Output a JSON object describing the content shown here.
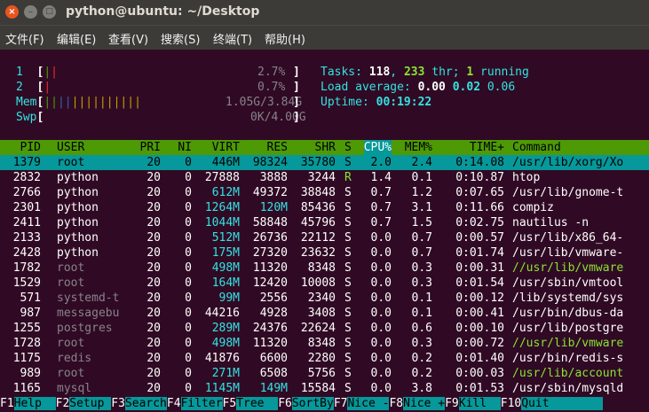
{
  "window": {
    "title": "python@ubuntu: ~/Desktop",
    "close_glyph": "×",
    "min_glyph": "–",
    "max_glyph": "□"
  },
  "menu": [
    "文件(F)",
    "编辑(E)",
    "查看(V)",
    "搜索(S)",
    "终端(T)",
    "帮助(H)"
  ],
  "meters": {
    "cpu1": {
      "label": "1",
      "value": "2.7%"
    },
    "cpu2": {
      "label": "2",
      "value": "0.7%"
    },
    "mem": {
      "label": "Mem",
      "value": "1.05G/3.84G"
    },
    "swp": {
      "label": "Swp",
      "value": "0K/4.00G"
    }
  },
  "stats": {
    "tasks_label": "Tasks:",
    "tasks": "118",
    "thr": "233",
    "thr_label": "thr;",
    "running": "1",
    "running_label": "running",
    "load_label": "Load average:",
    "load1": "0.00",
    "load5": "0.02",
    "load15": "0.06",
    "uptime_label": "Uptime:",
    "uptime": "00:19:22"
  },
  "columns": [
    "PID",
    "USER",
    "PRI",
    "NI",
    "VIRT",
    "RES",
    "SHR",
    "S",
    "CPU%",
    "MEM%",
    "TIME+",
    "Command"
  ],
  "processes": [
    {
      "pid": "1379",
      "user": "root",
      "pri": "20",
      "ni": "0",
      "virt": "446M",
      "res": "98324",
      "shr": "35780",
      "s": "S",
      "cpu": "2.0",
      "mem": "2.4",
      "time": "0:14.08",
      "cmd": "/usr/lib/xorg/Xo"
    },
    {
      "pid": "2832",
      "user": "python",
      "pri": "20",
      "ni": "0",
      "virt": "27888",
      "res": "3888",
      "shr": "3244",
      "s": "R",
      "cpu": "1.4",
      "mem": "0.1",
      "time": "0:10.87",
      "cmd": "htop"
    },
    {
      "pid": "2766",
      "user": "python",
      "pri": "20",
      "ni": "0",
      "virt": "612M",
      "res": "49372",
      "shr": "38848",
      "s": "S",
      "cpu": "0.7",
      "mem": "1.2",
      "time": "0:07.65",
      "cmd": "/usr/lib/gnome-t"
    },
    {
      "pid": "2301",
      "user": "python",
      "pri": "20",
      "ni": "0",
      "virt": "1264M",
      "res": "120M",
      "shr": "85436",
      "s": "S",
      "cpu": "0.7",
      "mem": "3.1",
      "time": "0:11.66",
      "cmd": "compiz"
    },
    {
      "pid": "2411",
      "user": "python",
      "pri": "20",
      "ni": "0",
      "virt": "1044M",
      "res": "58848",
      "shr": "45796",
      "s": "S",
      "cpu": "0.7",
      "mem": "1.5",
      "time": "0:02.75",
      "cmd": "nautilus -n"
    },
    {
      "pid": "2133",
      "user": "python",
      "pri": "20",
      "ni": "0",
      "virt": "512M",
      "res": "26736",
      "shr": "22112",
      "s": "S",
      "cpu": "0.0",
      "mem": "0.7",
      "time": "0:00.57",
      "cmd": "/usr/lib/x86_64-"
    },
    {
      "pid": "2428",
      "user": "python",
      "pri": "20",
      "ni": "0",
      "virt": "175M",
      "res": "27320",
      "shr": "23632",
      "s": "S",
      "cpu": "0.0",
      "mem": "0.7",
      "time": "0:01.74",
      "cmd": "/usr/lib/vmware-"
    },
    {
      "pid": "1782",
      "user": "root",
      "pri": "20",
      "ni": "0",
      "virt": "498M",
      "res": "11320",
      "shr": "8348",
      "s": "S",
      "cpu": "0.0",
      "mem": "0.3",
      "time": "0:00.31",
      "cmd": "//usr/lib/vmware"
    },
    {
      "pid": "1529",
      "user": "root",
      "pri": "20",
      "ni": "0",
      "virt": "164M",
      "res": "12420",
      "shr": "10008",
      "s": "S",
      "cpu": "0.0",
      "mem": "0.3",
      "time": "0:01.54",
      "cmd": "/usr/sbin/vmtool"
    },
    {
      "pid": "571",
      "user": "systemd-t",
      "pri": "20",
      "ni": "0",
      "virt": "99M",
      "res": "2556",
      "shr": "2340",
      "s": "S",
      "cpu": "0.0",
      "mem": "0.1",
      "time": "0:00.12",
      "cmd": "/lib/systemd/sys"
    },
    {
      "pid": "987",
      "user": "messagebu",
      "pri": "20",
      "ni": "0",
      "virt": "44216",
      "res": "4928",
      "shr": "3408",
      "s": "S",
      "cpu": "0.0",
      "mem": "0.1",
      "time": "0:00.41",
      "cmd": "/usr/bin/dbus-da"
    },
    {
      "pid": "1255",
      "user": "postgres",
      "pri": "20",
      "ni": "0",
      "virt": "289M",
      "res": "24376",
      "shr": "22624",
      "s": "S",
      "cpu": "0.0",
      "mem": "0.6",
      "time": "0:00.10",
      "cmd": "/usr/lib/postgre"
    },
    {
      "pid": "1728",
      "user": "root",
      "pri": "20",
      "ni": "0",
      "virt": "498M",
      "res": "11320",
      "shr": "8348",
      "s": "S",
      "cpu": "0.0",
      "mem": "0.3",
      "time": "0:00.72",
      "cmd": "//usr/lib/vmware"
    },
    {
      "pid": "1175",
      "user": "redis",
      "pri": "20",
      "ni": "0",
      "virt": "41876",
      "res": "6600",
      "shr": "2280",
      "s": "S",
      "cpu": "0.0",
      "mem": "0.2",
      "time": "0:01.40",
      "cmd": "/usr/bin/redis-s"
    },
    {
      "pid": "989",
      "user": "root",
      "pri": "20",
      "ni": "0",
      "virt": "271M",
      "res": "6508",
      "shr": "5756",
      "s": "S",
      "cpu": "0.0",
      "mem": "0.2",
      "time": "0:00.03",
      "cmd": "/usr/lib/account"
    },
    {
      "pid": "1165",
      "user": "mysql",
      "pri": "20",
      "ni": "0",
      "virt": "1145M",
      "res": "149M",
      "shr": "15584",
      "s": "S",
      "cpu": "0.0",
      "mem": "3.8",
      "time": "0:01.53",
      "cmd": "/usr/sbin/mysqld"
    }
  ],
  "footer": [
    {
      "key": "F1",
      "label": "Help  "
    },
    {
      "key": "F2",
      "label": "Setup "
    },
    {
      "key": "F3",
      "label": "Search"
    },
    {
      "key": "F4",
      "label": "Filter"
    },
    {
      "key": "F5",
      "label": "Tree  "
    },
    {
      "key": "F6",
      "label": "SortBy"
    },
    {
      "key": "F7",
      "label": "Nice -"
    },
    {
      "key": "F8",
      "label": "Nice +"
    },
    {
      "key": "F9",
      "label": "Kill  "
    },
    {
      "key": "F10",
      "label": "Quit"
    }
  ]
}
